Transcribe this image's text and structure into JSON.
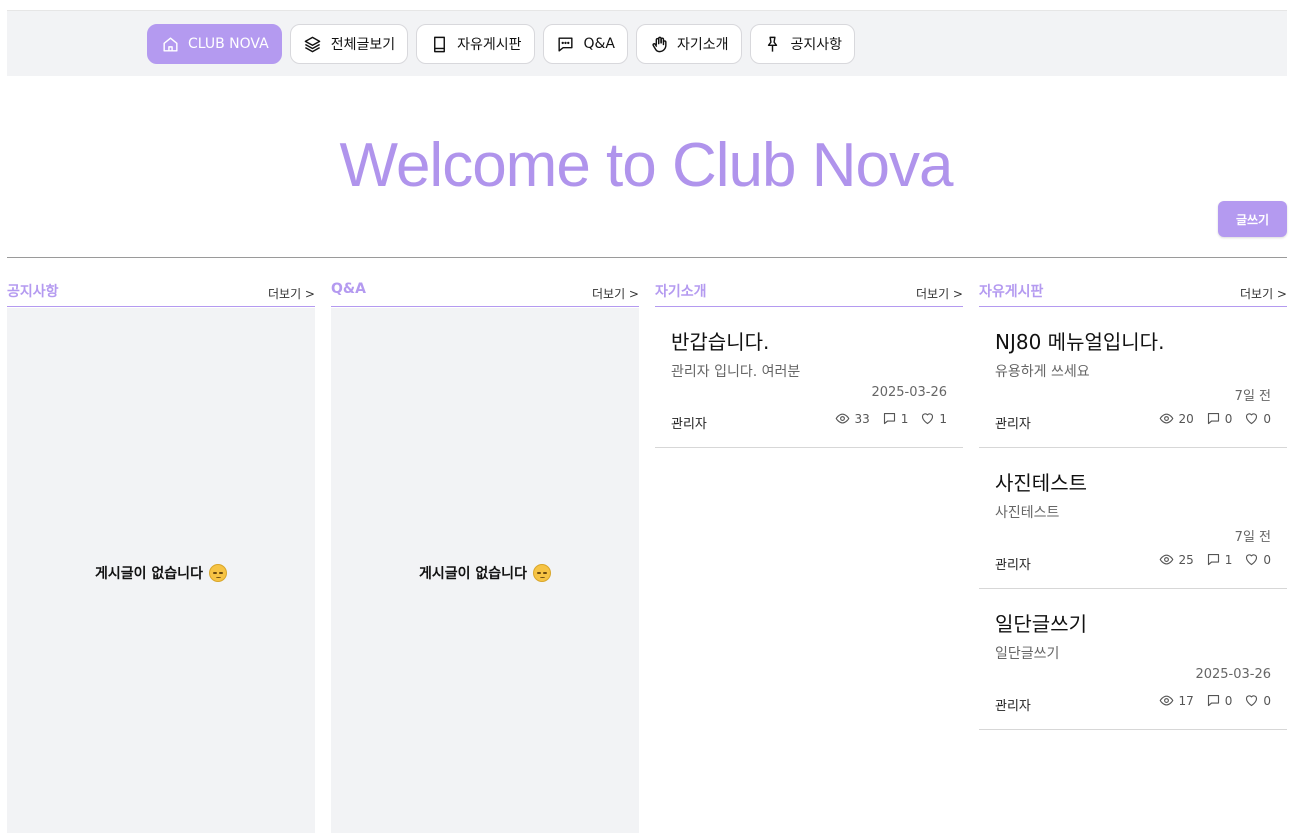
{
  "nav": {
    "items": [
      {
        "label": "CLUB NOVA",
        "icon": "home-icon"
      },
      {
        "label": "전체글보기",
        "icon": "layers-icon"
      },
      {
        "label": "자유게시판",
        "icon": "book-icon"
      },
      {
        "label": "Q&A",
        "icon": "message-dots-icon"
      },
      {
        "label": "자기소개",
        "icon": "hand-icon"
      },
      {
        "label": "공지사항",
        "icon": "pin-icon"
      }
    ]
  },
  "hero": {
    "title": "Welcome to Club Nova"
  },
  "actions": {
    "write_label": "글쓰기"
  },
  "colors": {
    "accent": "#b49af0",
    "panel_bg": "#f2f3f5"
  },
  "columns": [
    {
      "title": "공지사항",
      "more": "더보기 >",
      "empty": "게시글이 없습니다"
    },
    {
      "title": "Q&A",
      "more": "더보기 >",
      "empty": "게시글이 없습니다"
    },
    {
      "title": "자기소개",
      "more": "더보기 >",
      "posts": [
        {
          "title": "반갑습니다.",
          "body": "관리자 입니다. 여러분",
          "date": "2025-03-26",
          "author": "관리자",
          "views": "33",
          "comments": "1",
          "likes": "1"
        }
      ]
    },
    {
      "title": "자유게시판",
      "more": "더보기 >",
      "posts": [
        {
          "title": "NJ80 메뉴얼입니다.",
          "body": "유용하게 쓰세요",
          "date": "7일 전",
          "author": "관리자",
          "views": "20",
          "comments": "0",
          "likes": "0"
        },
        {
          "title": "사진테스트",
          "body": "사진테스트",
          "date": "7일 전",
          "author": "관리자",
          "views": "25",
          "comments": "1",
          "likes": "0"
        },
        {
          "title": "일단글쓰기",
          "body": "일단글쓰기",
          "date": "2025-03-26",
          "author": "관리자",
          "views": "17",
          "comments": "0",
          "likes": "0"
        }
      ]
    }
  ]
}
